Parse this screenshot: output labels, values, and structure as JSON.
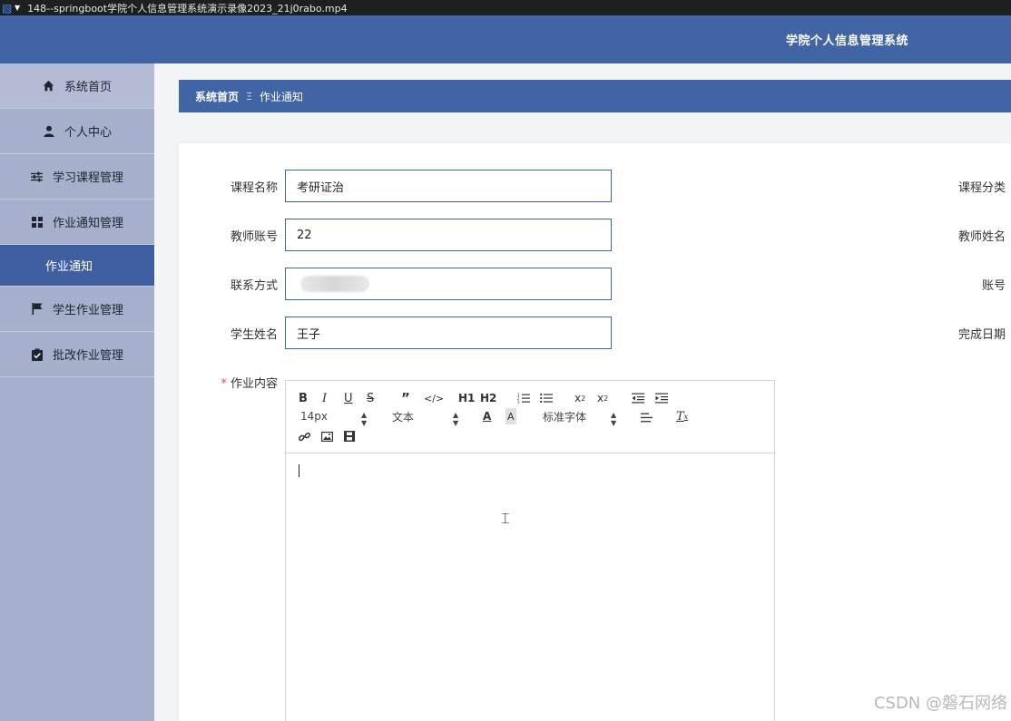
{
  "window": {
    "title": "148--springboot学院个人信息管理系统演示录像2023_21j0rabo.mp4"
  },
  "header": {
    "app_title": "学院个人信息管理系统"
  },
  "sidebar": {
    "items": [
      {
        "label": "系统首页",
        "icon": "home-icon"
      },
      {
        "label": "个人中心",
        "icon": "user-icon"
      },
      {
        "label": "学习课程管理",
        "icon": "sliders-icon"
      },
      {
        "label": "作业通知管理",
        "icon": "grid-icon"
      },
      {
        "label": "作业通知",
        "icon": ""
      },
      {
        "label": "学生作业管理",
        "icon": "flag-icon"
      },
      {
        "label": "批改作业管理",
        "icon": "clipboard-check-icon"
      }
    ]
  },
  "breadcrumb": {
    "home": "系统首页",
    "separator": "Ξ",
    "current": "作业通知"
  },
  "form": {
    "course_name_label": "课程名称",
    "course_name_value": "考研证治",
    "course_category_label": "课程分类",
    "teacher_account_label": "教师账号",
    "teacher_account_value": "22",
    "teacher_name_label": "教师姓名",
    "contact_label": "联系方式",
    "account_label": "账号",
    "student_name_label": "学生姓名",
    "student_name_value": "王子",
    "complete_date_label": "完成日期",
    "content_required_mark": "*",
    "content_label": "作业内容"
  },
  "editor": {
    "font_size": "14px",
    "paragraph_type": "文本",
    "font_family": "标准字体",
    "tools_row1": [
      "bold",
      "italic",
      "underline",
      "strike",
      "blockquote",
      "code-block",
      "h1",
      "h2",
      "ordered-list",
      "bullet-list",
      "subscript",
      "superscript",
      "outdent",
      "indent"
    ],
    "tools_row2": [
      "font-color",
      "background-color",
      "align",
      "clear-format"
    ],
    "tools_row3": [
      "link",
      "image",
      "video"
    ]
  },
  "watermark": "CSDN @磐石网络",
  "colors": {
    "primary": "#4164a4",
    "sidebar_bg": "#a6b0cc",
    "active_item": "#3f5fa0",
    "required": "#e24c4c"
  }
}
